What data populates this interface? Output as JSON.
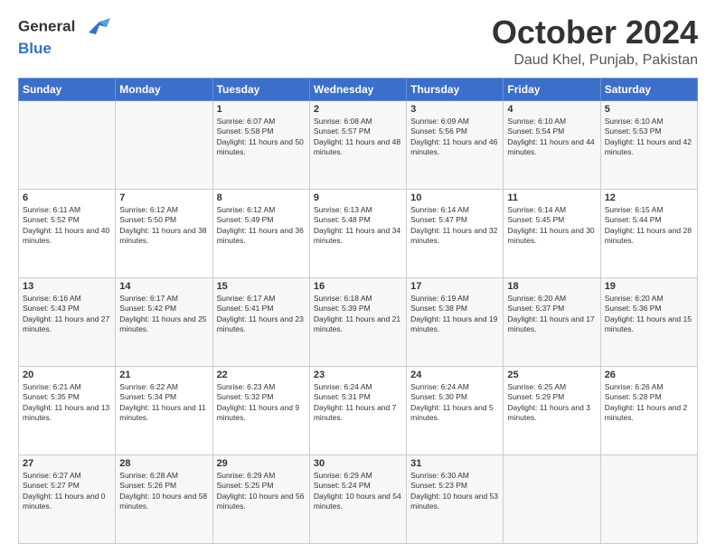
{
  "header": {
    "logo_line1": "General",
    "logo_line2": "Blue",
    "month": "October 2024",
    "location": "Daud Khel, Punjab, Pakistan"
  },
  "days_of_week": [
    "Sunday",
    "Monday",
    "Tuesday",
    "Wednesday",
    "Thursday",
    "Friday",
    "Saturday"
  ],
  "weeks": [
    [
      {
        "day": "",
        "info": ""
      },
      {
        "day": "",
        "info": ""
      },
      {
        "day": "1",
        "info": "Sunrise: 6:07 AM\nSunset: 5:58 PM\nDaylight: 11 hours and 50 minutes."
      },
      {
        "day": "2",
        "info": "Sunrise: 6:08 AM\nSunset: 5:57 PM\nDaylight: 11 hours and 48 minutes."
      },
      {
        "day": "3",
        "info": "Sunrise: 6:09 AM\nSunset: 5:56 PM\nDaylight: 11 hours and 46 minutes."
      },
      {
        "day": "4",
        "info": "Sunrise: 6:10 AM\nSunset: 5:54 PM\nDaylight: 11 hours and 44 minutes."
      },
      {
        "day": "5",
        "info": "Sunrise: 6:10 AM\nSunset: 5:53 PM\nDaylight: 11 hours and 42 minutes."
      }
    ],
    [
      {
        "day": "6",
        "info": "Sunrise: 6:11 AM\nSunset: 5:52 PM\nDaylight: 11 hours and 40 minutes."
      },
      {
        "day": "7",
        "info": "Sunrise: 6:12 AM\nSunset: 5:50 PM\nDaylight: 11 hours and 38 minutes."
      },
      {
        "day": "8",
        "info": "Sunrise: 6:12 AM\nSunset: 5:49 PM\nDaylight: 11 hours and 36 minutes."
      },
      {
        "day": "9",
        "info": "Sunrise: 6:13 AM\nSunset: 5:48 PM\nDaylight: 11 hours and 34 minutes."
      },
      {
        "day": "10",
        "info": "Sunrise: 6:14 AM\nSunset: 5:47 PM\nDaylight: 11 hours and 32 minutes."
      },
      {
        "day": "11",
        "info": "Sunrise: 6:14 AM\nSunset: 5:45 PM\nDaylight: 11 hours and 30 minutes."
      },
      {
        "day": "12",
        "info": "Sunrise: 6:15 AM\nSunset: 5:44 PM\nDaylight: 11 hours and 28 minutes."
      }
    ],
    [
      {
        "day": "13",
        "info": "Sunrise: 6:16 AM\nSunset: 5:43 PM\nDaylight: 11 hours and 27 minutes."
      },
      {
        "day": "14",
        "info": "Sunrise: 6:17 AM\nSunset: 5:42 PM\nDaylight: 11 hours and 25 minutes."
      },
      {
        "day": "15",
        "info": "Sunrise: 6:17 AM\nSunset: 5:41 PM\nDaylight: 11 hours and 23 minutes."
      },
      {
        "day": "16",
        "info": "Sunrise: 6:18 AM\nSunset: 5:39 PM\nDaylight: 11 hours and 21 minutes."
      },
      {
        "day": "17",
        "info": "Sunrise: 6:19 AM\nSunset: 5:38 PM\nDaylight: 11 hours and 19 minutes."
      },
      {
        "day": "18",
        "info": "Sunrise: 6:20 AM\nSunset: 5:37 PM\nDaylight: 11 hours and 17 minutes."
      },
      {
        "day": "19",
        "info": "Sunrise: 6:20 AM\nSunset: 5:36 PM\nDaylight: 11 hours and 15 minutes."
      }
    ],
    [
      {
        "day": "20",
        "info": "Sunrise: 6:21 AM\nSunset: 5:35 PM\nDaylight: 11 hours and 13 minutes."
      },
      {
        "day": "21",
        "info": "Sunrise: 6:22 AM\nSunset: 5:34 PM\nDaylight: 11 hours and 11 minutes."
      },
      {
        "day": "22",
        "info": "Sunrise: 6:23 AM\nSunset: 5:32 PM\nDaylight: 11 hours and 9 minutes."
      },
      {
        "day": "23",
        "info": "Sunrise: 6:24 AM\nSunset: 5:31 PM\nDaylight: 11 hours and 7 minutes."
      },
      {
        "day": "24",
        "info": "Sunrise: 6:24 AM\nSunset: 5:30 PM\nDaylight: 11 hours and 5 minutes."
      },
      {
        "day": "25",
        "info": "Sunrise: 6:25 AM\nSunset: 5:29 PM\nDaylight: 11 hours and 3 minutes."
      },
      {
        "day": "26",
        "info": "Sunrise: 6:26 AM\nSunset: 5:28 PM\nDaylight: 11 hours and 2 minutes."
      }
    ],
    [
      {
        "day": "27",
        "info": "Sunrise: 6:27 AM\nSunset: 5:27 PM\nDaylight: 11 hours and 0 minutes."
      },
      {
        "day": "28",
        "info": "Sunrise: 6:28 AM\nSunset: 5:26 PM\nDaylight: 10 hours and 58 minutes."
      },
      {
        "day": "29",
        "info": "Sunrise: 6:29 AM\nSunset: 5:25 PM\nDaylight: 10 hours and 56 minutes."
      },
      {
        "day": "30",
        "info": "Sunrise: 6:29 AM\nSunset: 5:24 PM\nDaylight: 10 hours and 54 minutes."
      },
      {
        "day": "31",
        "info": "Sunrise: 6:30 AM\nSunset: 5:23 PM\nDaylight: 10 hours and 53 minutes."
      },
      {
        "day": "",
        "info": ""
      },
      {
        "day": "",
        "info": ""
      }
    ]
  ]
}
